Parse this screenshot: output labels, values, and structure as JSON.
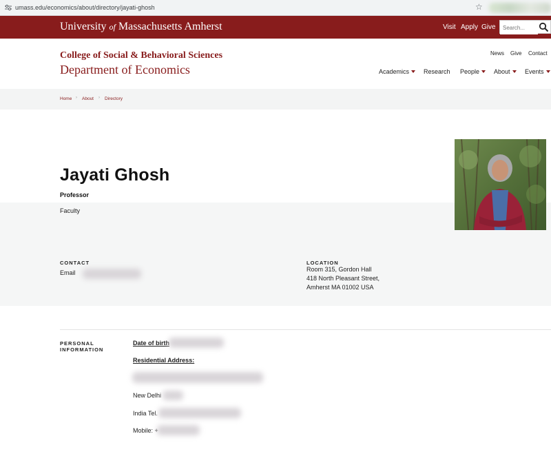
{
  "browser": {
    "url": "umass.edu/economics/about/directory/jayati-ghosh"
  },
  "header": {
    "brand_prefix": "University",
    "brand_of": "of",
    "brand_suffix": "Massachusetts Amherst",
    "links": [
      "Visit",
      "Apply",
      "Give"
    ],
    "search_placeholder": "Search..."
  },
  "department": {
    "college": "College of Social & Behavioral Sciences",
    "name": "Department of Economics",
    "utility_links": [
      "News",
      "Give",
      "Contact"
    ],
    "nav": [
      "Academics",
      "Research",
      "People",
      "About",
      "Events"
    ]
  },
  "breadcrumb": [
    "Home",
    "About",
    "Directory"
  ],
  "profile": {
    "name": "Jayati Ghosh",
    "title": "Professor",
    "type": "Faculty",
    "contact_heading": "CONTACT",
    "email_label": "Email",
    "location_heading": "LOCATION",
    "location_lines": [
      "Room 315, Gordon Hall",
      "418 North Pleasant Street,",
      "Amherst MA 01002 USA"
    ]
  },
  "personal": {
    "heading_line1": "PERSONAL",
    "heading_line2": "INFORMATION",
    "dob_label": "Date of birth",
    "address_label": "Residential Address:",
    "city": "New Delhi",
    "india_tel": "India Tel.",
    "mobile": "Mobile: +"
  },
  "colors": {
    "brand": "#881c1c",
    "band": "#f5f6f6"
  }
}
